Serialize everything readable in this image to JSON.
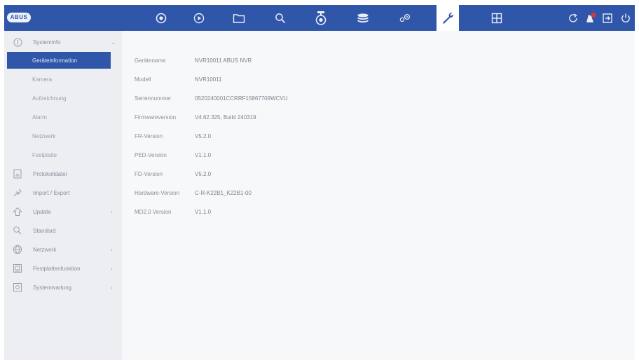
{
  "app": {
    "logo_text": "ABUS"
  },
  "topbar": {
    "icons": [
      "camera-icon",
      "playback-icon",
      "folder-icon",
      "search-icon",
      "ptz-camera-icon",
      "storage-icon",
      "settings-gears-icon",
      "maintenance-wrench-icon",
      "grid-view-icon"
    ],
    "right_icons": [
      "refresh-icon",
      "alarm-notification-icon",
      "logout-icon",
      "power-icon"
    ],
    "active_icon": "maintenance-wrench-icon",
    "colors": {
      "bar": "#2f56a8",
      "icon": "#e9eef9",
      "active_bg": "#ffffff",
      "alert_badge": "#d23b3b"
    }
  },
  "sidebar": {
    "items": [
      {
        "label": "Systeminfo",
        "icon": "info-icon",
        "has_chevron": true,
        "expanded": true
      },
      {
        "label": "Geräteinformation",
        "sub": true,
        "selected": true
      },
      {
        "label": "Kamera",
        "sub": true
      },
      {
        "label": "Aufzeichnung",
        "sub": true
      },
      {
        "label": "Alarm",
        "sub": true
      },
      {
        "label": "Netzwerk",
        "sub": true
      },
      {
        "label": "Festplatte",
        "sub": true
      },
      {
        "label": "Protokolldatei",
        "icon": "log-file-icon"
      },
      {
        "label": "Import / Export",
        "icon": "import-export-icon"
      },
      {
        "label": "Update",
        "icon": "update-icon",
        "has_chevron": true
      },
      {
        "label": "Standard",
        "icon": "default-reset-icon"
      },
      {
        "label": "Netzwerk",
        "icon": "network-globe-icon",
        "has_chevron": true
      },
      {
        "label": "Festplattenfunktion",
        "icon": "hdd-function-icon",
        "has_chevron": true
      },
      {
        "label": "Systemwartung",
        "icon": "system-maintenance-icon",
        "has_chevron": true
      }
    ]
  },
  "device_info": {
    "rows": [
      {
        "label": "Gerätename",
        "value": "NVR10011 ABUS NVR"
      },
      {
        "label": "Modell",
        "value": "NVR10011"
      },
      {
        "label": "Seriennummer",
        "value": "0520240001CCRRF15867709WCVU"
      },
      {
        "label": "Firmwareversion",
        "value": "V4.62.325, Build 240319"
      },
      {
        "label": "FR-Version",
        "value": "V5.2.0"
      },
      {
        "label": "PED-Version",
        "value": "V1.1.0"
      },
      {
        "label": "FD-Version",
        "value": "V5.2.0"
      },
      {
        "label": "Hardware-Version",
        "value": "C-R-K22B1_K22B1-00"
      },
      {
        "label": "MD2.0 Version",
        "value": "V1.1.0"
      }
    ]
  }
}
